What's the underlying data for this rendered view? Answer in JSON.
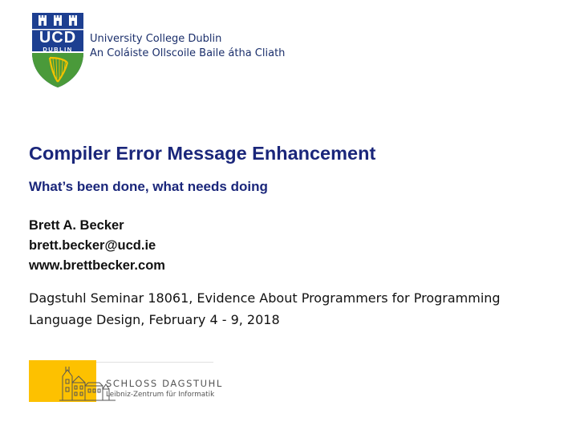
{
  "ucd": {
    "crest_text_top": "UCD",
    "crest_text_bottom": "DUBLIN",
    "name_en": "University College Dublin",
    "name_ga": "An Coláiste Ollscoile Baile átha Cliath",
    "colors": {
      "blue": "#1d3f91",
      "green": "#4a9a3a",
      "gold": "#f2c200"
    }
  },
  "title": "Compiler Error Message Enhancement",
  "subtitle": "What’s been done, what needs doing",
  "author": {
    "name": "Brett A. Becker",
    "email": "brett.becker@ucd.ie",
    "website": "www.brettbecker.com"
  },
  "seminar": {
    "line1": "Dagstuhl Seminar 18061, Evidence About Programmers for Programming",
    "line2": "Language Design, February 4 - 9, 2018"
  },
  "dagstuhl": {
    "name": "SCHLOSS DAGSTUHL",
    "subtitle": "Leibniz-Zentrum für Informatik",
    "color": "#fdc100"
  }
}
